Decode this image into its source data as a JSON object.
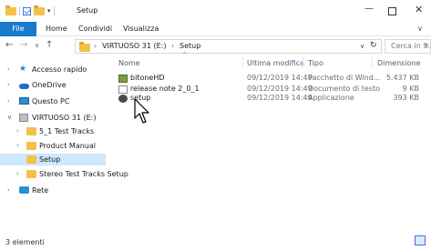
{
  "window": {
    "title": "Setup",
    "qa_toolbar_arrow": "▾",
    "minimize_glyph": "—",
    "close_glyph": "✕"
  },
  "ribbon": {
    "tabs": [
      "File",
      "Home",
      "Condividi",
      "Visualizza"
    ],
    "expand_glyph": "∨"
  },
  "address_bar": {
    "back_glyph": "←",
    "forward_glyph": "→",
    "recent_glyph": "∨",
    "up_glyph": "↑",
    "breadcrumbs": [
      "VIRTUOSO 31 (E:)",
      "Setup"
    ],
    "separator": "›",
    "leading_separator": "›",
    "dropdown_glyph": "∨",
    "refresh_glyph": "↻"
  },
  "search": {
    "placeholder": "Cerca in S...",
    "icon_glyph": "⌕"
  },
  "nav_pane": {
    "items": [
      {
        "label": "Accesso rapido",
        "icon": "star-icon",
        "expander": "›"
      },
      {
        "label": "OneDrive",
        "icon": "cloud-icon",
        "expander": "›"
      },
      {
        "label": "Questo PC",
        "icon": "computer-icon",
        "expander": "›"
      },
      {
        "label": "VIRTUOSO 31 (E:)",
        "icon": "drive-icon",
        "expander": "∨"
      },
      {
        "label": "5_1 Test Tracks",
        "icon": "folder-icon",
        "expander": "›"
      },
      {
        "label": "Product Manual",
        "icon": "folder-icon",
        "expander": "›"
      },
      {
        "label": "Setup",
        "icon": "folder-icon",
        "expander": "",
        "selected": true
      },
      {
        "label": "Stereo Test Tracks Setup",
        "icon": "folder-icon",
        "expander": "›"
      },
      {
        "label": "Rete",
        "icon": "network-icon",
        "expander": "›"
      }
    ]
  },
  "file_list": {
    "sort_glyph": "^",
    "columns": {
      "name": "Nome",
      "date": "Ultima modifica",
      "type": "Tipo",
      "size": "Dimensione"
    },
    "rows": [
      {
        "name": "bitoneHD",
        "date": "09/12/2019 14:49",
        "type": "Pacchetto di Wind...",
        "size": "5.437 KB",
        "icon": "package-icon"
      },
      {
        "name": "release note 2_0_1",
        "date": "09/12/2019 14:49",
        "type": "Documento di testo",
        "size": "9 KB",
        "icon": "text-document-icon"
      },
      {
        "name": "setup",
        "date": "09/12/2019 14:49",
        "type": "Applicazione",
        "size": "393 KB",
        "icon": "application-icon"
      }
    ]
  },
  "status_bar": {
    "item_count": "3 elementi"
  }
}
